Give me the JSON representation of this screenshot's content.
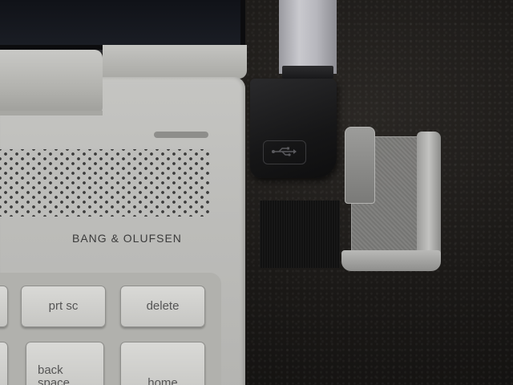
{
  "laptop": {
    "brand_text": "BANG & OLUFSEN",
    "keys": {
      "prt_sc": "prt sc",
      "delete": "delete",
      "backspace_line1": "back",
      "backspace_line2": "space",
      "home": "home"
    }
  },
  "connector": {
    "logo_icon": "usb-trident-icon"
  },
  "colors": {
    "aluminum": "#c5c5c2",
    "leather": "#1b1917",
    "connector": "#161617",
    "printed_clip": "#8a8a88"
  }
}
